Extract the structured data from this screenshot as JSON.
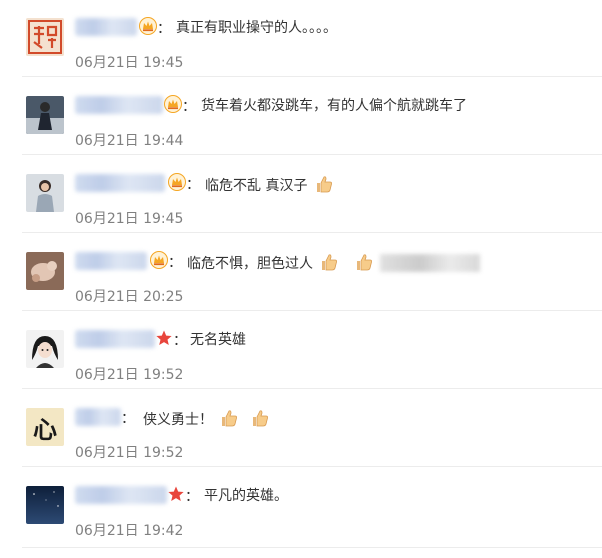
{
  "comments": [
    {
      "text": "真正有职业操守的人。。。。",
      "time": "06月21日 19:45",
      "badge": "crown",
      "avatar_icon": "seal-avatar"
    },
    {
      "text": "货车着火都没跳车，有的人偏个航就跳车了",
      "time": "06月21日 19:44",
      "badge": "crown",
      "avatar_icon": "person-avatar"
    },
    {
      "text": "临危不乱 真汉子",
      "time": "06月21日 19:45",
      "badge": "crown",
      "avatar_icon": "person-avatar"
    },
    {
      "text": "临危不惧，胆色过人",
      "time": "06月21日 20:25",
      "badge": "crown",
      "avatar_icon": "pet-avatar"
    },
    {
      "text": "无名英雄",
      "time": "06月21日 19:52",
      "badge": "star",
      "avatar_icon": "anime-avatar"
    },
    {
      "text": "侠义勇士！",
      "time": "06月21日 19:52",
      "badge": "none",
      "avatar_icon": "heart-char-avatar"
    },
    {
      "text": "平凡的英雄。",
      "time": "06月21日 19:42",
      "badge": "star",
      "avatar_icon": "night-sky-avatar"
    }
  ],
  "colon": "：",
  "avatar_char": "心",
  "colors": {
    "time": "#808080",
    "text": "#333333",
    "separator": "#ececec",
    "crown": "#f5a623",
    "star": "#e8453c"
  },
  "icons": [
    "crown-icon",
    "star-icon",
    "thumbs-up-icon"
  ]
}
